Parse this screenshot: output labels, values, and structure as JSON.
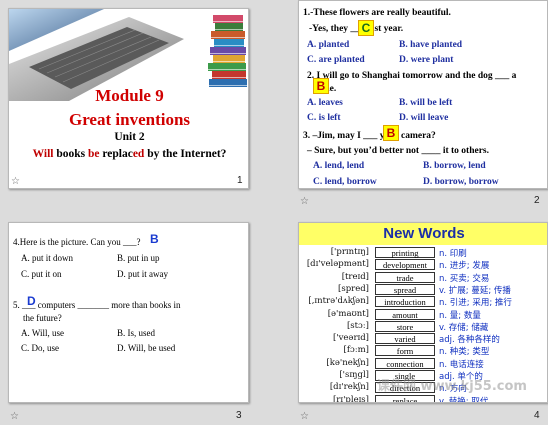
{
  "slide1": {
    "title": "Module 9",
    "subtitle": "Great inventions",
    "unit": "Unit 2",
    "question_parts": [
      {
        "t": "Will",
        "c": "#c00000"
      },
      {
        "t": " books ",
        "c": "#000000"
      },
      {
        "t": "be",
        "c": "#c00000"
      },
      {
        "t": " replac",
        "c": "#000000"
      },
      {
        "t": "ed",
        "c": "#c00000"
      },
      {
        "t": " by the Internet?",
        "c": "#000000"
      }
    ],
    "number": "1",
    "star": "☆"
  },
  "slide2": {
    "q1_line1": "1.-These flowers are really beautiful.",
    "q1_line2": "-Yes, they ___ last year.",
    "q1_answer": "C",
    "q1_opts": [
      "A. planted",
      "B. have planted",
      "C. are planted",
      "D.  were plant"
    ],
    "q2_line1": "2. I will go to Shanghai tomorrow and the dog ___ a",
    "q2_line2": "lone.",
    "q2_answer": "B",
    "q2_opts": [
      "A. leaves",
      "B. will be left",
      "C. is left",
      "D. will leave"
    ],
    "q3_line1": "3. –Jim, may I ___ your camera?",
    "q3_answer": "B",
    "q3_line2": "– Sure, but you’d better not ____ it to others.",
    "q3_opts": [
      "A. lend, lend",
      "B. borrow, lend",
      "C. lend, borrow",
      "D. borrow, borrow"
    ],
    "number": "2",
    "star": "☆"
  },
  "slide3": {
    "q4_line": "4.Here is the picture. Can you ___?",
    "q4_answer": "B",
    "q4_opts": [
      "A. put it down",
      "B. put in up",
      "C. put it on",
      "D. put it away"
    ],
    "q5_line1": "5. ___ computers _______ more than books in",
    "q5_line2": "the future?",
    "q5_answer": "D",
    "q5_opts": [
      "A. Will,  use",
      "B. Is, used",
      "C. Do, use",
      "D. Will, be used"
    ],
    "number": "3",
    "star": "☆"
  },
  "slide4": {
    "title": "New Words",
    "rows": [
      {
        "phon": "['prɪntɪŋ]",
        "word": "printing",
        "mean": "n. 印刷"
      },
      {
        "phon": "[dɪ'veləpmənt]",
        "word": "development",
        "mean": "n. 进步; 发展"
      },
      {
        "phon": "[treɪd]",
        "word": "trade",
        "mean": "n. 买卖; 交易"
      },
      {
        "phon": "[spred]",
        "word": "spread",
        "mean": "v. 扩展; 蔓延; 传播"
      },
      {
        "phon": "[,ɪntrə'dʌkʃən]",
        "word": "introduction",
        "mean": "n. 引进; 采用; 推行"
      },
      {
        "phon": "[ə'maʊnt]",
        "word": "amount",
        "mean": "n. 量; 数量"
      },
      {
        "phon": "[stɔː]",
        "word": "store",
        "mean": "v. 存储; 储藏"
      },
      {
        "phon": "['veərɪd]",
        "word": "varied",
        "mean": "adj. 各种各样的"
      },
      {
        "phon": "[fɔːm]",
        "word": "form",
        "mean": "n. 种类; 类型"
      },
      {
        "phon": "[kə'nekʃn]",
        "word": "connection",
        "mean": "n. 电话连接"
      },
      {
        "phon": "['sɪŋgl]",
        "word": "single",
        "mean": "adj. 单个的"
      },
      {
        "phon": "[dɪ'rekʃn]",
        "word": "direction",
        "mean": "n. 方向"
      },
      {
        "phon": "[rɪ'pleɪs]",
        "word": "replace",
        "mean": "v. 替换; 取代"
      }
    ],
    "number": "4",
    "star": "☆",
    "watermark": "课件网 www.kj55.com"
  }
}
